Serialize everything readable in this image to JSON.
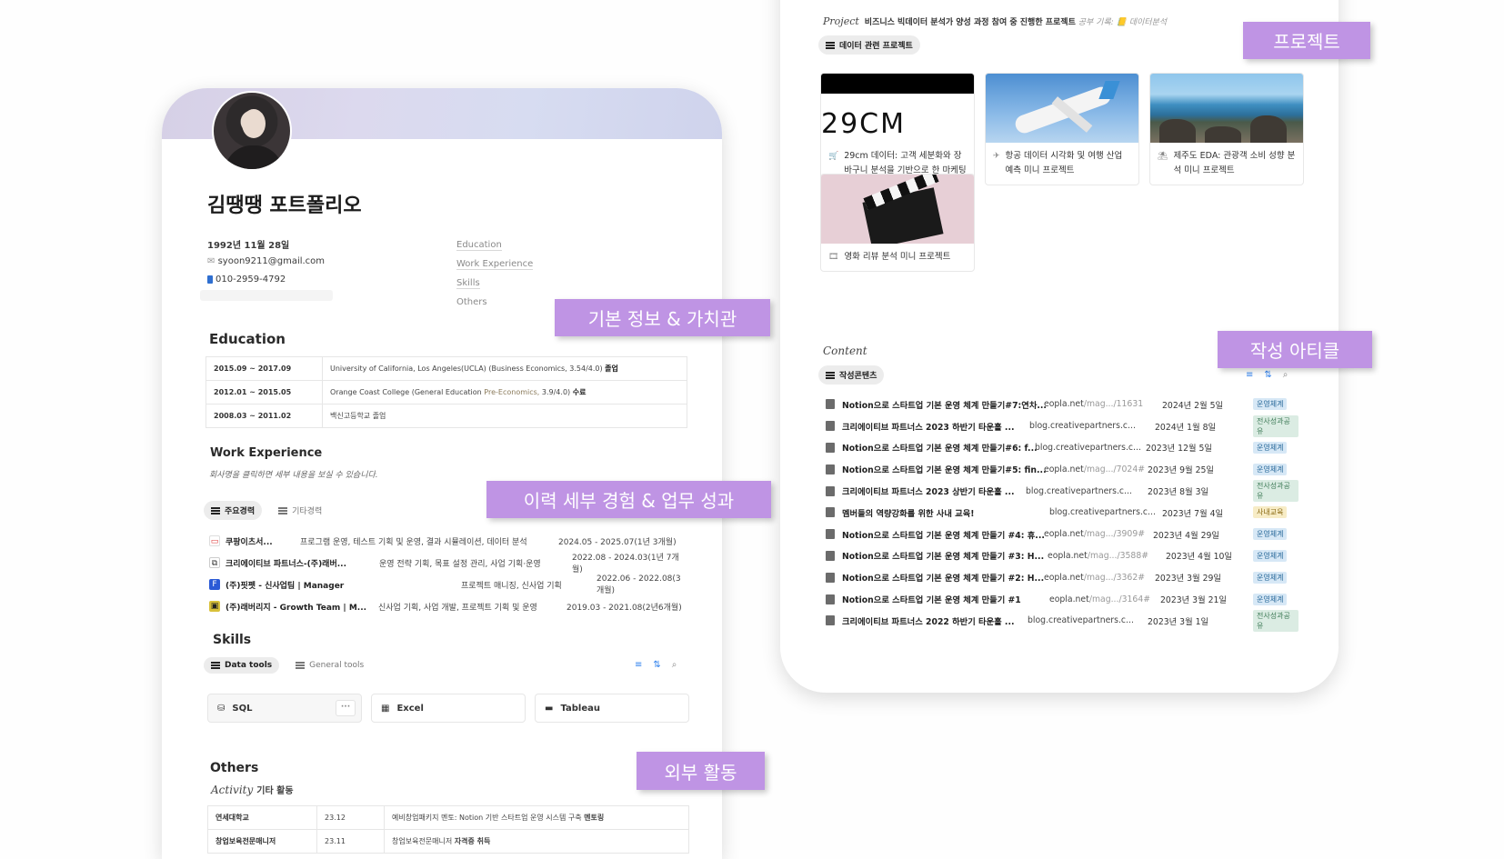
{
  "left": {
    "title": "김땡땡 포트폴리오",
    "dob": "1992년 11월 28일",
    "email": "syoon9211@gmail.com",
    "phone": "010-2959-4792",
    "toc": [
      "Education",
      "Work Experience",
      "Skills",
      "Others"
    ],
    "education": {
      "heading": "Education",
      "rows": [
        {
          "date": "2015.09 ~ 2017.09",
          "school": "University of California, Los Angeles(UCLA) (Business Economics, 3.54/4.0)",
          "extra": "",
          "status": "졸업"
        },
        {
          "date": "2012.01 ~ 2015.05",
          "school": "Orange Coast College (General Education",
          "extra": "Pre-Economics,",
          "tail": "3.9/4.0)",
          "status": "수료"
        },
        {
          "date": "2008.03 ~ 2011.02",
          "school": "백신고등학교 졸업",
          "extra": "",
          "status": ""
        }
      ]
    },
    "work": {
      "heading": "Work Experience",
      "subtitle": "회사명을 클릭하면 세부 내용을 보실 수 있습니다.",
      "tabs": [
        "주요경력",
        "기타경력"
      ],
      "rows": [
        {
          "name": "쿠팡이츠서...",
          "desc": "프로그램 운영, 테스트 기획 및 운영, 결과 시뮬레이션, 데이터 분석",
          "period": "2024.05 - 2025.07(1년 3개월)"
        },
        {
          "name": "크리에이티브 파트너스-(주)래버...",
          "desc": "운영 전략 기획, 목표 설정 관리, 사업 기획·운영",
          "period": "2022.08 - 2024.03(1년 7개월)"
        },
        {
          "name": "(주)핏펫 - 신사업팀 | Manager",
          "desc": "프로젝트 매니징, 신사업 기획",
          "period": "2022.06 - 2022.08(3개월)"
        },
        {
          "name": "(주)래버리지 - Growth Team | M...",
          "desc": "신사업 기획, 사업 개발, 프로젝트 기획 및 운영",
          "period": "2019.03 - 2021.08(2년6개월)"
        }
      ]
    },
    "skills": {
      "heading": "Skills",
      "tabs": [
        "Data tools",
        "General tools"
      ],
      "cards": [
        "SQL",
        "Excel",
        "Tableau"
      ],
      "more": "···"
    },
    "others": {
      "heading": "Others",
      "activity_label": "Activity",
      "activity_sub": "기타 활동",
      "rows": [
        {
          "org": "연세대학교",
          "year": "23.12",
          "desc": "예비창업패키지 멘토: Notion 기반 스타트업 운영 시스템 구축",
          "bold": "멘토링"
        },
        {
          "org": "창업보육전문매니저",
          "year": "23.11",
          "desc": "창업보육전문매니저",
          "bold": "자격증 취득"
        }
      ]
    }
  },
  "right": {
    "project_label": "Project",
    "project_desc": "비즈니스 빅데이터 분석가 양성 과정 참여 중 진행한 프로젝트",
    "project_note": "공부 기록: 📒 데이터분석",
    "project_tab": "데이터 관련 프로젝트",
    "gallery": [
      {
        "title": "29cm 데이터: 고객 세분화와 장바구니 분석을 기반으로 한 마케팅 활용 방안",
        "img": "29CM"
      },
      {
        "title": "항공 데이터 시각화 및 여행 산업 예측 미니 프로젝트",
        "img": ""
      },
      {
        "title": "제주도 EDA: 관광객 소비 성향 분석 미니 프로젝트",
        "img": ""
      },
      {
        "title": "영화 리뷰 분석 미니 프로젝트",
        "img": ""
      }
    ],
    "content_label": "Content",
    "content_tab": "작성콘텐츠",
    "articles": [
      {
        "title": "Notion으로 스타트업 기본 운영 체계 만들기#7:연차...",
        "src": "eopla.net",
        "srcm": "/mag.../11631",
        "date": "2024년 2월 5일",
        "tag": "운영체계",
        "color": "blue"
      },
      {
        "title": "크리에이티브 파트너스 2023 하반기 타운홀 ...",
        "src": "blog.creativepartners.c...",
        "srcm": "",
        "date": "2024년 1월 8일",
        "tag": "전사성과공유",
        "color": "green"
      },
      {
        "title": "Notion으로 스타트업 기본 운영 체계 만들기#6: f...",
        "src": "blog.creativepartners.c...",
        "srcm": "",
        "date": "2023년 12월 5일",
        "tag": "운영체계",
        "color": "blue"
      },
      {
        "title": "Notion으로 스타트업 기본 운영 체계 만들기#5: fin...",
        "src": "eopla.net",
        "srcm": "/mag.../7024#",
        "date": "2023년 9월 25일",
        "tag": "운영체계",
        "color": "blue"
      },
      {
        "title": "크리에이티브 파트너스 2023 상반기 타운홀 ...",
        "src": "blog.creativepartners.c...",
        "srcm": "",
        "date": "2023년 8월 3일",
        "tag": "전사성과공유",
        "color": "green"
      },
      {
        "title": "멤버들의 역량강화를 위한 사내 교육!",
        "src": "blog.creativepartners.c...",
        "srcm": "",
        "date": "2023년 7월 4일",
        "tag": "사내교육",
        "color": "yellow"
      },
      {
        "title": "Notion으로 스타트업 기본 운영 체계 만들기 #4: 휴...",
        "src": "eopla.net",
        "srcm": "/mag.../3909#",
        "date": "2023년 4월 29일",
        "tag": "운영체계",
        "color": "blue"
      },
      {
        "title": "Notion으로 스타트업 기본 운영 체계 만들기 #3: H...",
        "src": "eopla.net",
        "srcm": "/mag.../3588#",
        "date": "2023년 4월 10일",
        "tag": "운영체계",
        "color": "blue"
      },
      {
        "title": "Notion으로 스타트업 기본 운영 체계 만들기 #2: H...",
        "src": "eopla.net",
        "srcm": "/mag.../3362#",
        "date": "2023년 3월 29일",
        "tag": "운영체계",
        "color": "blue"
      },
      {
        "title": "Notion으로 스타트업 기본 운영 체계 만들기 #1",
        "src": "eopla.net",
        "srcm": "/mag.../3164#",
        "date": "2023년 3월 21일",
        "tag": "운영체계",
        "color": "blue"
      },
      {
        "title": "크리에이티브 파트너스 2022 하반기 타운홀 ...",
        "src": "blog.creativepartners.c...",
        "srcm": "",
        "date": "2023년 3월 1일",
        "tag": "전사성과공유",
        "color": "green"
      }
    ]
  },
  "callouts": {
    "project": "프로젝트",
    "basic": "기본 정보 & 가치관",
    "article": "작성 아티클",
    "career": "이력 세부 경험 & 업무 성과",
    "external": "외부 활동"
  },
  "colors": {
    "callout": "#bf94e4",
    "tag_blue": "#d7e8f6",
    "tag_green": "#dbece3",
    "tag_yellow": "#f7ecc6"
  }
}
